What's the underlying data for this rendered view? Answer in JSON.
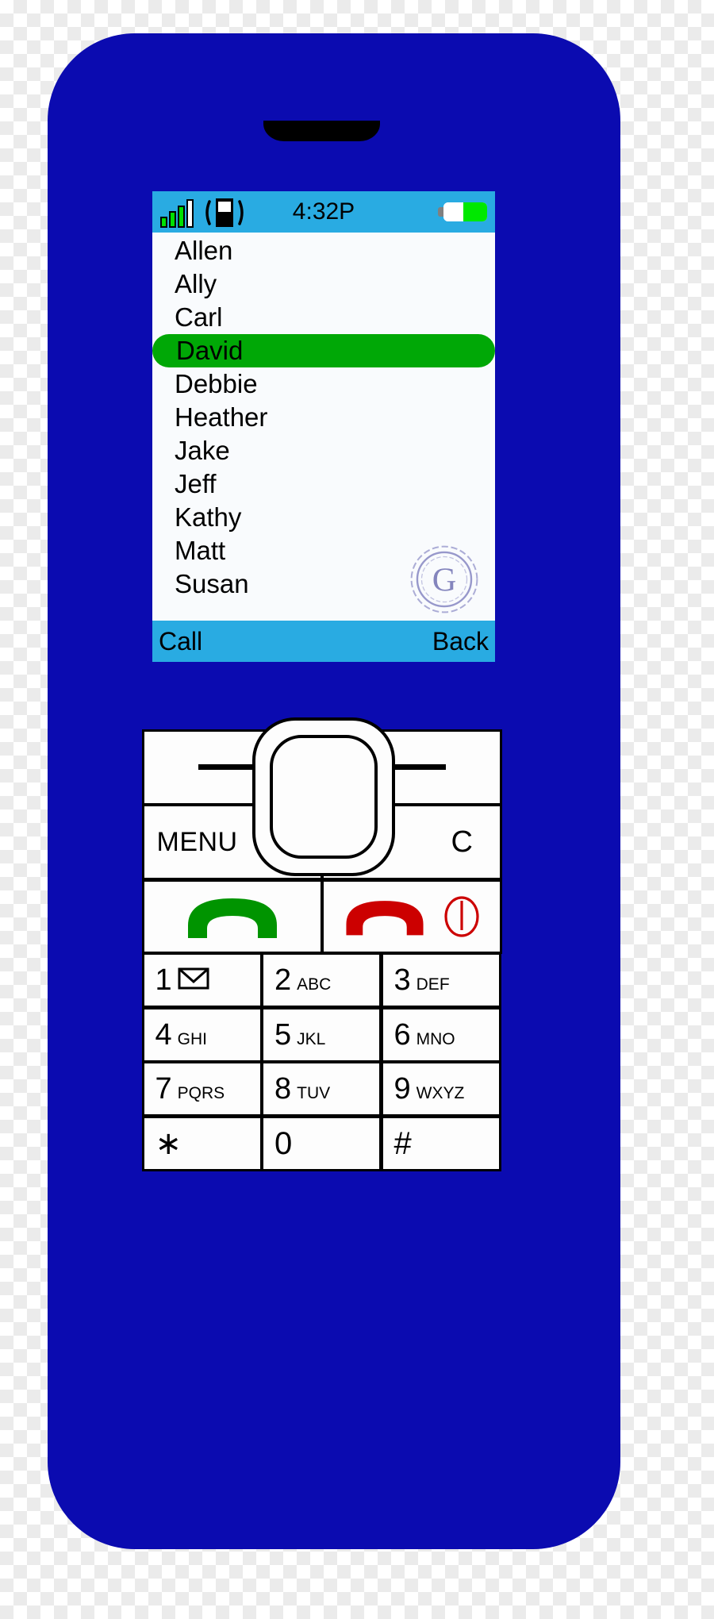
{
  "device": {
    "name": "feature-phone",
    "body_color": "#0b0bb0",
    "earpiece_color": "#000000"
  },
  "screen": {
    "background": "#f9fbfd",
    "status_bar": {
      "background": "#29abe2",
      "time": "4:32P",
      "signal": {
        "icon": "signal-bars-icon",
        "bars_filled": 3,
        "bars_total": 4,
        "filled_color": "#00e000",
        "empty_color": "#ffffff"
      },
      "vibrate": {
        "icon": "vibrate-phone-icon"
      },
      "battery": {
        "icon": "battery-icon",
        "level_percent": 54,
        "fill_color": "#00e800"
      }
    },
    "contacts": {
      "selected_index": 3,
      "highlight_color": "#00a806",
      "items": [
        {
          "name": "Allen"
        },
        {
          "name": "Ally"
        },
        {
          "name": "Carl"
        },
        {
          "name": "David"
        },
        {
          "name": "Debbie"
        },
        {
          "name": "Heather"
        },
        {
          "name": "Jake"
        },
        {
          "name": "Jeff"
        },
        {
          "name": "Kathy"
        },
        {
          "name": "Matt"
        },
        {
          "name": "Susan"
        }
      ]
    },
    "watermark": {
      "icon": "circular-g-stamp-watermark",
      "letter": "G",
      "color": "#5b5bab"
    },
    "softkeys": {
      "background": "#29abe2",
      "left_label": "Call",
      "right_label": "Back"
    }
  },
  "keypad": {
    "soft_row": {
      "left": {
        "icon": "dash-icon"
      },
      "right": {
        "icon": "dash-icon"
      }
    },
    "menu_row": {
      "left_label": "MENU",
      "right_label": "C"
    },
    "call_row": {
      "call": {
        "icon": "green-handset-icon",
        "color": "#009400"
      },
      "end": {
        "icon": "red-handset-icon",
        "color": "#cc0000"
      },
      "power": {
        "icon": "power-icon",
        "color": "#cc0000"
      }
    },
    "dpad": {
      "icon": "dpad-navigation-key"
    },
    "rows": [
      [
        {
          "digit": "1",
          "letters": "",
          "icon": "envelope-icon"
        },
        {
          "digit": "2",
          "letters": "ABC",
          "icon": ""
        },
        {
          "digit": "3",
          "letters": "DEF",
          "icon": ""
        }
      ],
      [
        {
          "digit": "4",
          "letters": "GHI",
          "icon": ""
        },
        {
          "digit": "5",
          "letters": "JKL",
          "icon": ""
        },
        {
          "digit": "6",
          "letters": "MNO",
          "icon": ""
        }
      ],
      [
        {
          "digit": "7",
          "letters": "PQRS",
          "icon": ""
        },
        {
          "digit": "8",
          "letters": "TUV",
          "icon": ""
        },
        {
          "digit": "9",
          "letters": "WXYZ",
          "icon": ""
        }
      ],
      [
        {
          "digit": "∗",
          "letters": "",
          "icon": ""
        },
        {
          "digit": "0",
          "letters": "",
          "icon": ""
        },
        {
          "digit": "#",
          "letters": "",
          "icon": ""
        }
      ]
    ]
  }
}
